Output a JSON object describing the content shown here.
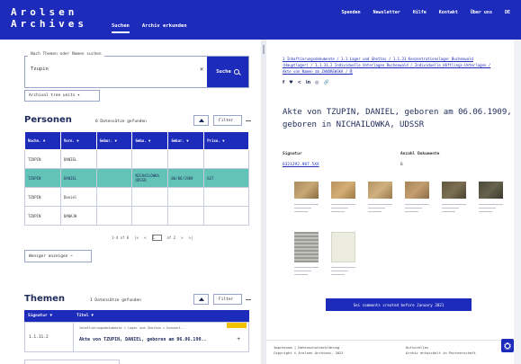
{
  "header": {
    "logo_line1": "Arolsen",
    "logo_line2": "Archives",
    "tabs": [
      "Suchen",
      "Archiv erkunden"
    ],
    "links": [
      "Spenden",
      "Newsletter",
      "Hilfe",
      "Kontakt",
      "Über uns",
      "DE"
    ]
  },
  "search": {
    "legend": "Nach Themen oder Namen suchen",
    "value": "Tzupin",
    "clear": "×",
    "button_label": "Suche"
  },
  "archive_tree_label": "Archival tree units ▾",
  "persons": {
    "title": "Personen",
    "found": "6 Datensätze gefunden",
    "filter_label": "Filter",
    "columns": [
      "Nachn.",
      "Vorn.",
      "Gebur.",
      "Gebu.",
      "Gebur.",
      "Priso."
    ],
    "rows": [
      [
        "TZUPIN",
        "DANIEL",
        "",
        "",
        "",
        ""
      ],
      [
        "TZUPIN",
        "DANIEL",
        "",
        "NICHAILOWKA UDSSR",
        "06/06/1909",
        "627"
      ],
      [
        "TZUPIN",
        "Daniel",
        "",
        "",
        "",
        ""
      ],
      [
        "TZUPIN",
        "DANAJH",
        "",
        "",
        "",
        ""
      ]
    ],
    "pagination": [
      "1-4 of 6",
      "|<",
      "<",
      "1",
      "of 2",
      ">",
      ">|"
    ],
    "less_button": "Weniger anzeigen ~"
  },
  "themes": {
    "title": "Themen",
    "found": "1 Datensätze gefunden",
    "filter_label": "Filter",
    "col_signature": "Signatur",
    "col_title": "Titel",
    "row_signature": "1.1.31.2",
    "row_path": "Inhaftierungsdokumente > Lager und Ghettos > Konzent...",
    "row_title": "Akte von TZUPIN, DANIEL, geboren am 06.06.190..",
    "row_plus": "+"
  },
  "detail": {
    "breadcrumb": "1 Inhaftierungsdokumente / 1.1 Lager und Ghettos / 1.1.31 Konzentrationslager Buchenwald (Hauptlager) / 1.1.31.2 Individuelle Unterlagen Buchenwald / Individuelle Häftlings-Unterlagen / Akte von Namen ab ZANDREWSKA / ⎘",
    "social": [
      "f",
      "♥",
      "<",
      "in",
      "◎",
      "🔗"
    ],
    "title": "Akte von TZUPIN, DANIEL, geboren am 06.06.1909, geboren in NICHAILOWKA, UDSSR",
    "signature_label": "Signatur",
    "signature_value": "6321292.987.5XX",
    "count_label": "Anzahl Dokumente",
    "count_value": "6",
    "comment_button": "Sei comments created before January 2021"
  },
  "footer": {
    "col1": [
      "Impressum | Datenschutzerklärung",
      "Copyright © Arolsen Archives, 2021"
    ],
    "col2": [
      "Kulturelles",
      "Archiv entwickelt in Partnerschaft"
    ]
  },
  "colors": {
    "brand_blue": "#1c2bb9",
    "selected_row": "#63c3b7",
    "badge_yellow": "#f2c200"
  }
}
